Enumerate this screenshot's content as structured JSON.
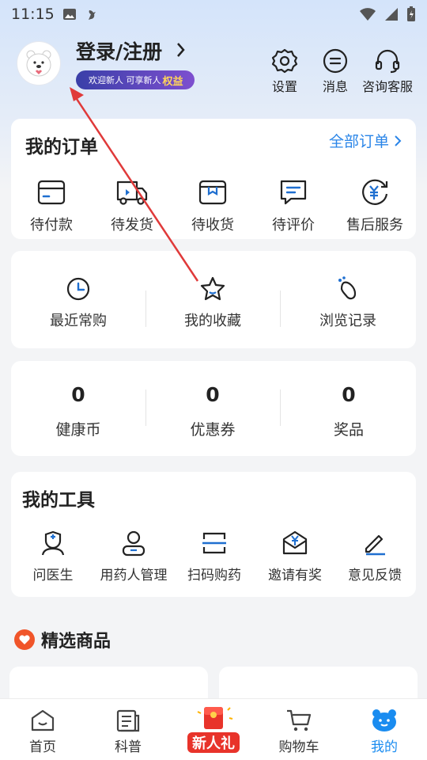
{
  "status_bar": {
    "time": "11:15"
  },
  "profile": {
    "login_label": "登录/注册",
    "badge_text": "欢迎新人 可享新人",
    "badge_highlight": "权益"
  },
  "header_actions": [
    {
      "label": "设置",
      "icon": "gear-icon"
    },
    {
      "label": "消息",
      "icon": "message-icon"
    },
    {
      "label": "咨询客服",
      "icon": "headset-icon"
    }
  ],
  "orders": {
    "title": "我的订单",
    "all_label": "全部订单",
    "items": [
      {
        "label": "待付款",
        "icon": "wallet-icon"
      },
      {
        "label": "待发货",
        "icon": "truck-icon"
      },
      {
        "label": "待收货",
        "icon": "package-icon"
      },
      {
        "label": "待评价",
        "icon": "comment-icon"
      },
      {
        "label": "售后服务",
        "icon": "yuan-refund-icon"
      }
    ]
  },
  "shortcuts": [
    {
      "label": "最近常购",
      "icon": "clock-icon"
    },
    {
      "label": "我的收藏",
      "icon": "star-icon"
    },
    {
      "label": "浏览记录",
      "icon": "footprint-icon"
    }
  ],
  "stats": [
    {
      "value": "0",
      "label": "健康币"
    },
    {
      "value": "0",
      "label": "优惠券"
    },
    {
      "value": "0",
      "label": "奖品"
    }
  ],
  "tools": {
    "title": "我的工具",
    "items": [
      {
        "label": "问医生",
        "icon": "doctor-icon"
      },
      {
        "label": "用药人管理",
        "icon": "user-icon"
      },
      {
        "label": "扫码购药",
        "icon": "scan-icon"
      },
      {
        "label": "邀请有奖",
        "icon": "invite-icon"
      },
      {
        "label": "意见反馈",
        "icon": "feedback-icon"
      }
    ]
  },
  "featured": {
    "title": "精选商品"
  },
  "tabbar": [
    {
      "label": "首页",
      "icon": "home-icon",
      "active": false
    },
    {
      "label": "科普",
      "icon": "article-icon",
      "active": false
    },
    {
      "label": "新人礼",
      "icon": "gift-icon",
      "active": false
    },
    {
      "label": "购物车",
      "icon": "cart-icon",
      "active": false
    },
    {
      "label": "我的",
      "icon": "bear-icon",
      "active": true
    }
  ],
  "colors": {
    "accent": "#2a85e8",
    "icon_blue": "#1f6fd0",
    "active_tab": "#1a8cf0",
    "annotation": "#e03a3a"
  }
}
